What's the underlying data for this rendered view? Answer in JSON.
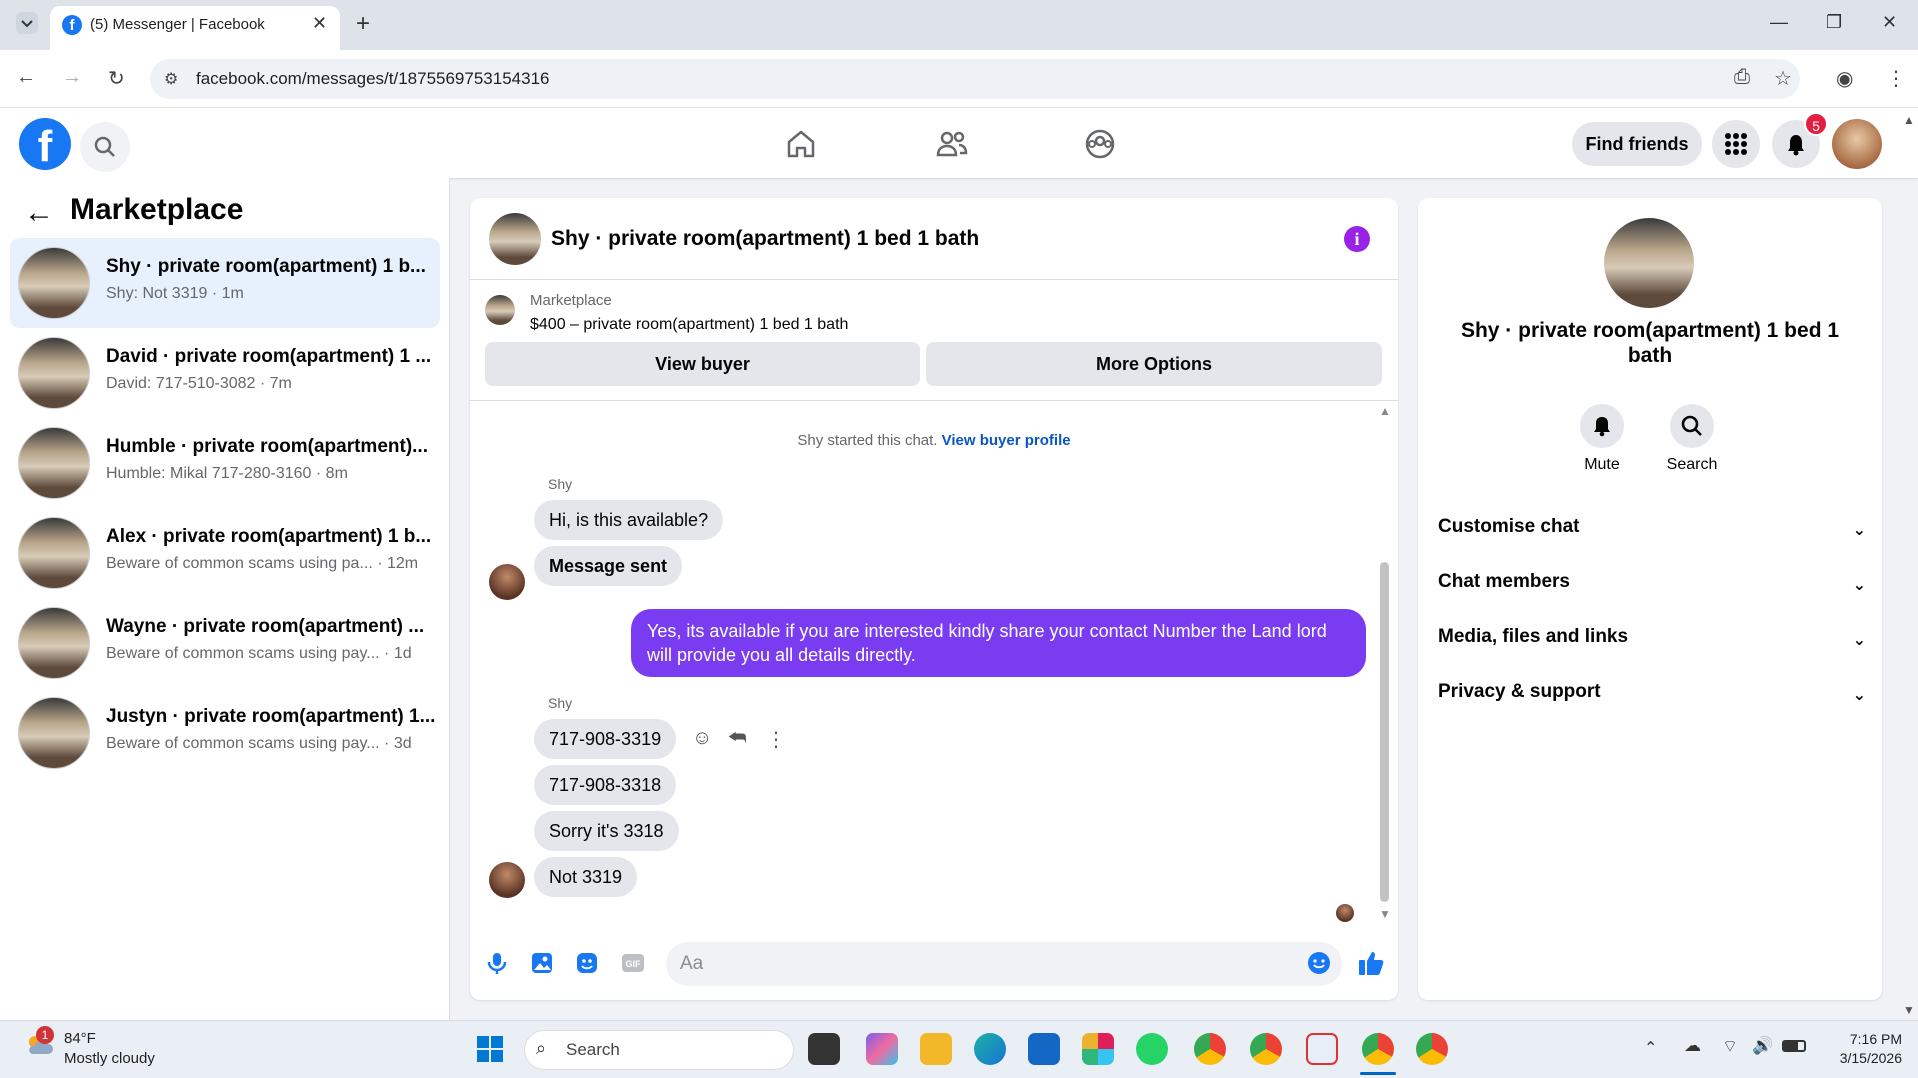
{
  "browser": {
    "tab_title": "(5) Messenger | Facebook",
    "url": "facebook.com/messages/t/1875569753154316"
  },
  "header": {
    "find_friends": "Find friends",
    "notification_count": "5"
  },
  "sidebar": {
    "title": "Marketplace",
    "conversations": [
      {
        "name": "Shy · private room(apartment) 1 b...",
        "preview": "Shy: Not 3319 · 1m"
      },
      {
        "name": "David · private room(apartment) 1 ...",
        "preview": "David: 717-510-3082 · 7m"
      },
      {
        "name": "Humble · private room(apartment)...",
        "preview": "Humble: Mikal 717-280-3160 · 8m"
      },
      {
        "name": "Alex · private room(apartment) 1 b...",
        "preview": "Beware of common scams using pa... · 12m"
      },
      {
        "name": "Wayne · private room(apartment) ...",
        "preview": "Beware of common scams using pay... · 1d"
      },
      {
        "name": "Justyn · private room(apartment) 1...",
        "preview": "Beware of common scams using pay... · 3d"
      }
    ]
  },
  "chat": {
    "title": "Shy · private room(apartment) 1 bed 1 bath",
    "marketplace_label": "Marketplace",
    "listing": "$400 – private room(apartment) 1 bed 1 bath",
    "view_buyer": "View buyer",
    "more_options": "More Options",
    "started_text": "Shy started this chat.",
    "view_buyer_profile": "View buyer profile",
    "sender1": "Shy",
    "msg1": "Hi, is this available?",
    "msg2": "Message sent",
    "out1": "Yes, its available if you are interested kindly share your contact Number the Land lord will provide you all details directly.",
    "sender2": "Shy",
    "msg3": "717-908-3319",
    "msg4": "717-908-3318",
    "msg5": "Sorry it's 3318",
    "msg6": "Not 3319",
    "compose_placeholder": "Aa"
  },
  "details": {
    "title": "Shy · private room(apartment) 1 bed 1 bath",
    "mute": "Mute",
    "search": "Search",
    "sections": [
      "Customise chat",
      "Chat members",
      "Media, files and links",
      "Privacy & support"
    ]
  },
  "taskbar": {
    "weather_badge": "1",
    "temp": "84°F",
    "condition": "Mostly cloudy",
    "search": "Search",
    "time": "7:16 PM",
    "date": "3/15/2026"
  },
  "colors": {
    "brand": "#1877f2",
    "outgoing_bubble": "#7a3cf1",
    "info": "#9a22e6",
    "badge": "#e41e3f"
  }
}
